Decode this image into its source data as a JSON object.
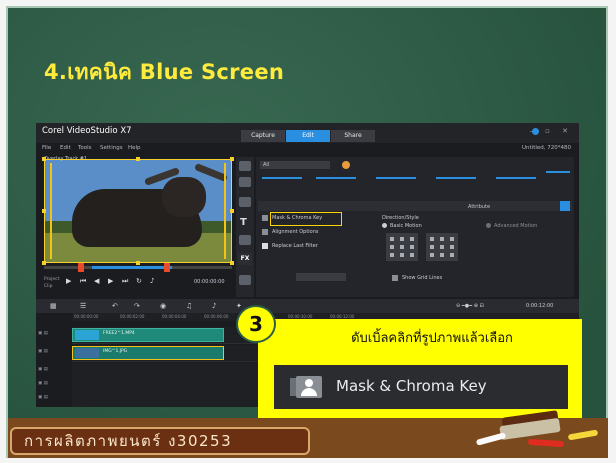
{
  "slide": {
    "title": "4.เทคนิค Blue Screen",
    "footer": "การผลิตภาพยนตร์ ง30253"
  },
  "app": {
    "window_title": "Corel VideoStudio X7",
    "mode_tabs": [
      "Capture",
      "Edit",
      "Share"
    ],
    "active_tab": "Edit",
    "menu": [
      "File",
      "Edit",
      "Tools",
      "Settings",
      "Help"
    ],
    "project_info": "Untitled, 720*480",
    "preview_label": "Overlay Track #1",
    "playback": {
      "project_label": "Project",
      "clip_label": "Clip",
      "timecode": "00:00:00:00"
    },
    "options": {
      "dropdown_all": "All",
      "attribute_tab": "Attribute",
      "mask_chroma_key": "Mask & Chroma Key",
      "alignment_options": "Alignment Options",
      "replace_last_filter": "Replace Last Filter",
      "direction_style": "Direction/Style",
      "basic_motion": "Basic Motion",
      "advanced_motion": "Advanced Motion",
      "show_grid_lines": "Show Grid Lines"
    },
    "timeline": {
      "ruler": [
        "00:00:00:00",
        "00:00:02:00",
        "00:00:04:00",
        "00:00:06:00",
        "00:00:08:00",
        "00:00:10:00",
        "00:00:12:00"
      ],
      "clips": [
        {
          "name": "FREE2^1.MP4"
        },
        {
          "name": "IMG^1.JPG"
        }
      ],
      "zoom_time": "0:00:12:00"
    }
  },
  "callout": {
    "step": "3",
    "instruction": "ดับเบิ้ลคลิกที่รูปภาพแล้วเลือก",
    "option_label": "Mask & Chroma Key"
  },
  "colors": {
    "board": "#2c5e46",
    "title": "#ffeb3b",
    "highlight": "#ffff00",
    "accent": "#2a8fe0"
  }
}
